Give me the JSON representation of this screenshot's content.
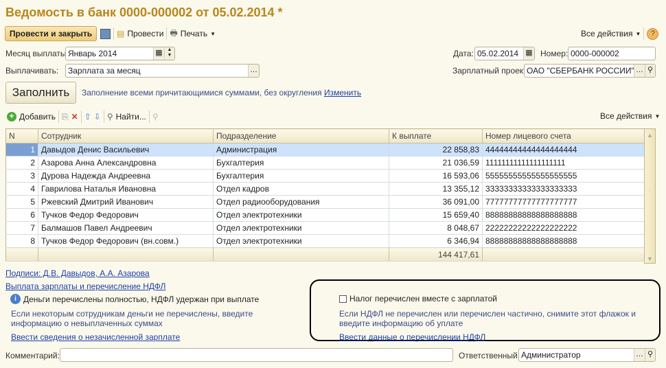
{
  "title": "Ведомость в банк 0000-000002 от 05.02.2014 *",
  "toolbar": {
    "post_close": "Провести и закрыть",
    "post": "Провести",
    "print": "Печать",
    "all_actions": "Все действия"
  },
  "form": {
    "month_label": "Месяц выплаты:",
    "month_value": "Январь 2014",
    "pay_label": "Выплачивать:",
    "pay_value": "Зарплата за месяц",
    "date_label": "Дата:",
    "date_value": "05.02.2014",
    "number_label": "Номер:",
    "number_value": "0000-000002",
    "project_label": "Зарплатный проект:",
    "project_value": "ОАО \"СБЕРБАНК РОССИИ\"",
    "fill_button": "Заполнить",
    "fill_note": "Заполнение всеми причитающимися суммами, без округления",
    "fill_change": "Изменить"
  },
  "table_toolbar": {
    "add": "Добавить",
    "find": "Найти...",
    "all_actions": "Все действия"
  },
  "table": {
    "columns": [
      "N",
      "Сотрудник",
      "Подразделение",
      "К выплате",
      "Номер лицевого счета"
    ],
    "rows": [
      [
        "1",
        "Давыдов Денис Васильевич",
        "Администрация",
        "22 858,83",
        "44444444444444444444"
      ],
      [
        "2",
        "Азарова Анна Александровна",
        "Бухгалтерия",
        "21 036,59",
        "11111111111111111111"
      ],
      [
        "3",
        "Дурова Надежда Андреевна",
        "Бухгалтерия",
        "16 593,06",
        "55555555555555555555"
      ],
      [
        "4",
        "Гаврилова Наталья Ивановна",
        "Отдел кадров",
        "13 355,12",
        "33333333333333333333"
      ],
      [
        "5",
        "Ржевский Дмитрий Иванович",
        "Отдел радиооборудования",
        "36 091,00",
        "77777777777777777777"
      ],
      [
        "6",
        "Тучков Федор Федорович",
        "Отдел электротехники",
        "15 659,40",
        "88888888888888888888"
      ],
      [
        "7",
        "Балмашов Павел Андреевич",
        "Отдел электротехники",
        "8 048,67",
        "22222222222222222222"
      ],
      [
        "8",
        "Тучков Федор Федорович (вн.совм.)",
        "Отдел электротехники",
        "6 346,94",
        "88888888888888888888"
      ]
    ],
    "total": "144 417,61"
  },
  "bottom": {
    "signatures": "Подписи: Д.В. Давыдов, А.А. Азарова",
    "payment_link": "Выплата зарплаты и перечисление НДФЛ",
    "info": "Деньги перечислены  полностью, НДФЛ удержан при выплате",
    "info_hint": "Если некоторым сотрудникам деньги не перечислены, введите информацию о невыплаченных суммах",
    "unpaid_link": "Ввести сведения о незачисленной зарплате",
    "tax_checkbox": "Налог перечислен вместе с зарплатой",
    "tax_hint": "Если НДФЛ не перечислен или перечислен частично, снимите этот флажок и введите информацию об уплате",
    "tax_link": "Ввести данные о перечислении НДФЛ",
    "comment_label": "Комментарий:",
    "comment_value": "",
    "responsible_label": "Ответственный:",
    "responsible_value": "Администратор"
  }
}
